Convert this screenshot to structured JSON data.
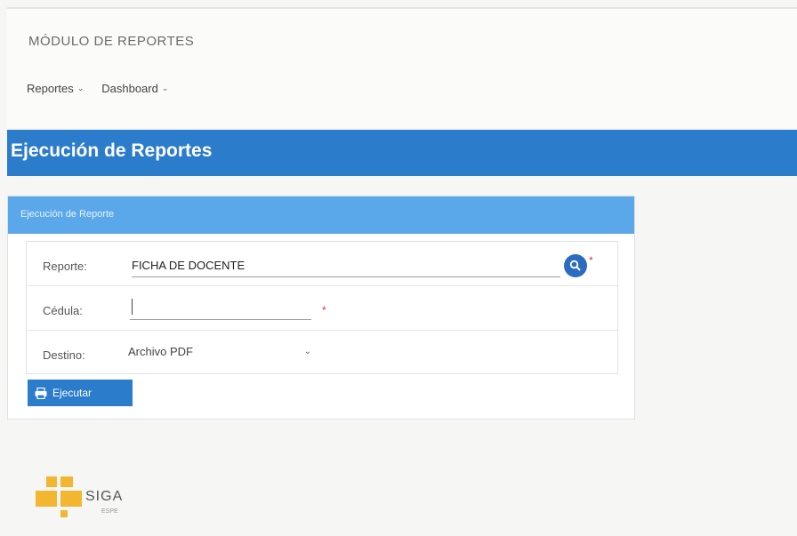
{
  "header": {
    "module_title": "MÓDULO DE REPORTES",
    "menu": [
      {
        "label": "Reportes",
        "icon": "chevron-down-icon"
      },
      {
        "label": "Dashboard",
        "icon": "chevron-down-icon"
      }
    ]
  },
  "page": {
    "title": "Ejecución de Reportes"
  },
  "panel": {
    "title": "Ejecución de Reporte",
    "fields": {
      "reporte": {
        "label": "Reporte:",
        "value": "FICHA DE DOCENTE",
        "required_mark": "*",
        "search_icon": "search-icon"
      },
      "cedula": {
        "label": "Cédula:",
        "value": "",
        "required_mark": "*"
      },
      "destino": {
        "label": "Destino:",
        "value": "Archivo PDF",
        "icon": "chevron-down-icon"
      }
    },
    "run_button": {
      "label": "Ejecutar",
      "icon": "printer-icon"
    }
  },
  "logo": {
    "text": "SIGA",
    "sub": "ESPE"
  },
  "colors": {
    "banner": "#2b7ccb",
    "panel_header": "#5aa8ea",
    "search_button": "#2b6cc0",
    "logo": "#f2b630",
    "required": "#d33333"
  }
}
